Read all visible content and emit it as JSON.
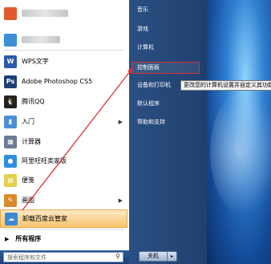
{
  "start_menu": {
    "programs": [
      {
        "label": "",
        "icon": "blurred-app-icon",
        "color": "#e05a2b"
      },
      {
        "label": "",
        "icon": "blurred-app-icon",
        "color": "#3d8fd6"
      },
      {
        "label": "WPS文字",
        "icon": "wps-writer-icon",
        "color": "#2a5caa",
        "glyph": "W"
      },
      {
        "label": "Adobe Photoshop CS5",
        "icon": "photoshop-icon",
        "color": "#1d3f74",
        "glyph": "Ps"
      },
      {
        "label": "腾讯QQ",
        "icon": "qq-penguin-icon",
        "color": "#222222",
        "glyph": "🐧"
      },
      {
        "label": "入门",
        "icon": "getting-started-icon",
        "color": "#4a90d9",
        "glyph": "▮",
        "submenu": true
      },
      {
        "label": "计算器",
        "icon": "calculator-icon",
        "color": "#6b7c93",
        "glyph": "▦"
      },
      {
        "label": "阿里旺旺卖家版",
        "icon": "aliwangwang-icon",
        "color": "#2f8ee0",
        "glyph": "●"
      },
      {
        "label": "便笺",
        "icon": "sticky-notes-icon",
        "color": "#e3d04a",
        "glyph": "▤"
      },
      {
        "label": "画图",
        "icon": "paint-icon",
        "color": "#d98a2b",
        "glyph": "✎",
        "submenu": true
      },
      {
        "label": "卸载百度云管家",
        "icon": "uninstall-icon",
        "color": "#3a8ad6",
        "glyph": "☁",
        "highlighted": true
      }
    ],
    "all_programs": "所有程序",
    "search_placeholder": "搜索程序和文件",
    "right_items": [
      {
        "label": "音乐"
      },
      {
        "label": "游戏"
      },
      {
        "label": "计算机"
      },
      {
        "label": "控制面板",
        "selected": true
      },
      {
        "label": "设备和打印机"
      },
      {
        "label": "默认程序"
      },
      {
        "label": "帮助和支持"
      }
    ],
    "tooltip": "更改您的计算机设置并自定义其功能",
    "shutdown_label": "关机",
    "shutdown_arrow": "▸"
  },
  "colors": {
    "highlight": "#f7c46f",
    "selection_border": "#d93030",
    "annotation_arrow": "#e03030"
  }
}
